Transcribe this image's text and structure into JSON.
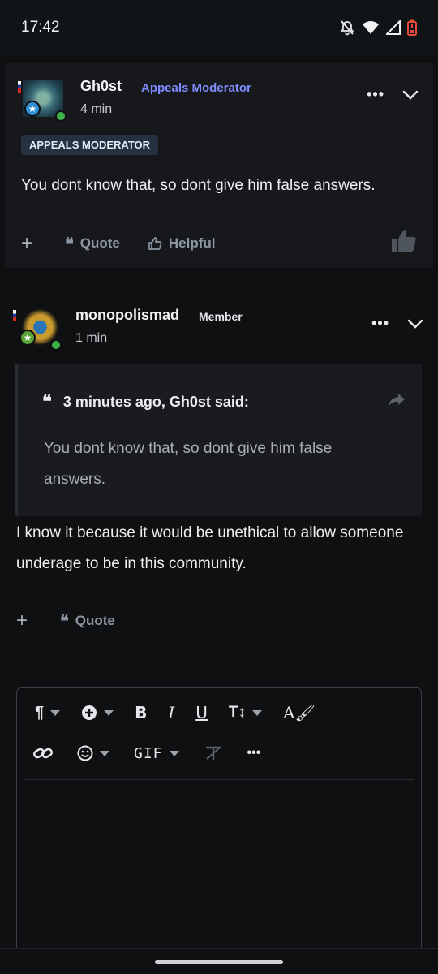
{
  "status": {
    "time": "17:42"
  },
  "posts": [
    {
      "author": "Gh0st",
      "role": "Appeals Moderator",
      "time": "4 min",
      "badge": "APPEALS MODERATOR",
      "content": "You dont know that, so dont give him false answers.",
      "actions": {
        "quote": "Quote",
        "helpful": "Helpful"
      }
    },
    {
      "author": "monopolismad",
      "role": "Member",
      "time": "1 min",
      "quote_header": "3 minutes ago, Gh0st said:",
      "quote_text": "You dont know that, so dont give him false answers.",
      "content": "I know it because it would be unethical to allow someone underage to be in this community.",
      "actions": {
        "quote": "Quote"
      }
    }
  ],
  "editor": {
    "gif_label": "GIF"
  },
  "colors": {
    "moderator": "#7f8cff",
    "accent_online": "#3bb34a",
    "badge_bg": "#253140"
  }
}
